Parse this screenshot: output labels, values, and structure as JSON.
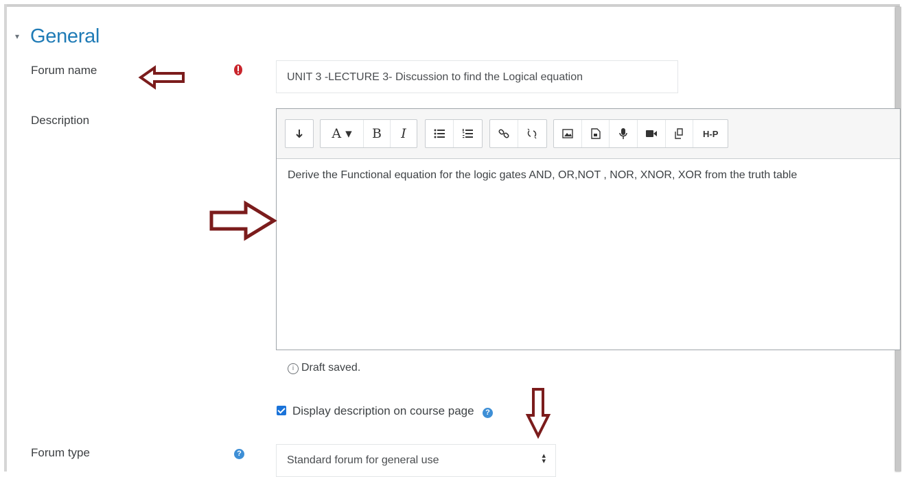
{
  "section": {
    "title": "General"
  },
  "forum_name": {
    "label": "Forum name",
    "value": "UNIT 3 -LECTURE 3- Discussion to find the Logical equation"
  },
  "description": {
    "label": "Description",
    "toolbar": {
      "expand": "↕",
      "font": "A ▾",
      "bold": "B",
      "italic": "I",
      "h5p": "H-P"
    },
    "content": "Derive the Functional equation for the logic gates AND, OR,NOT , NOR, XNOR, XOR from the truth table"
  },
  "draft_status": "Draft saved.",
  "display_description": {
    "label": "Display description on course page",
    "checked": true
  },
  "forum_type": {
    "label": "Forum type",
    "selected": "Standard forum for general use"
  },
  "colors": {
    "accent": "#1f7bb6",
    "arrow": "#7b1c1c",
    "required": "#c9252c",
    "help": "#3e8fd6"
  }
}
